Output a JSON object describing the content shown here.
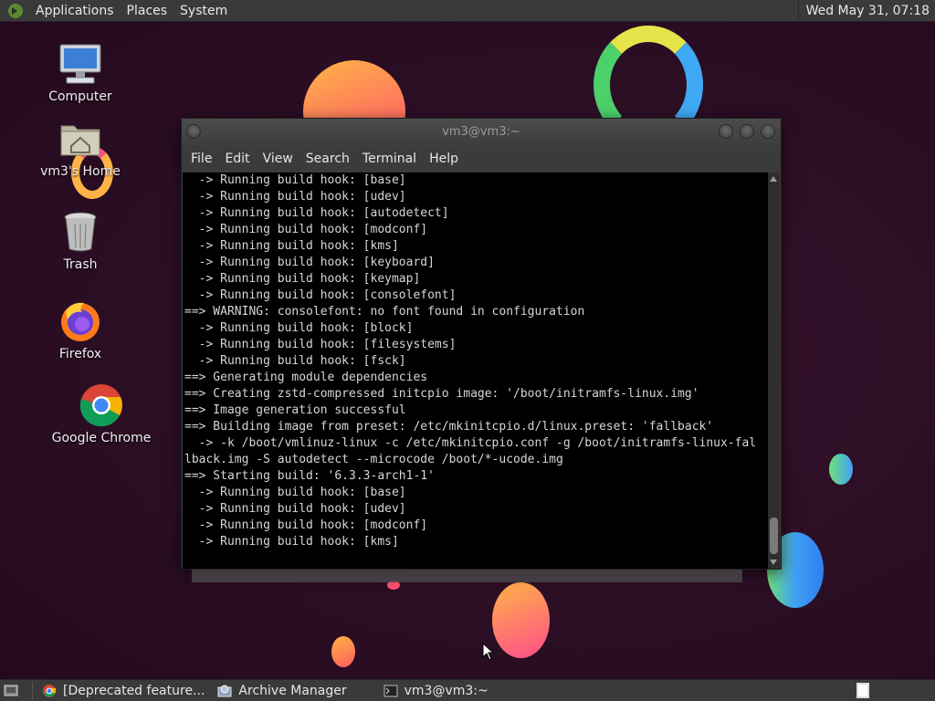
{
  "top_panel": {
    "menus": [
      "Applications",
      "Places",
      "System"
    ],
    "clock": "Wed May 31, 07:18"
  },
  "desktop_icons": [
    {
      "label": "Computer",
      "icon": "computer-icon"
    },
    {
      "label": "vm3's Home",
      "icon": "home-folder-icon"
    },
    {
      "label": "Trash",
      "icon": "trash-icon"
    },
    {
      "label": "Firefox",
      "icon": "firefox-icon"
    },
    {
      "label": "Google Chrome",
      "icon": "chrome-icon"
    }
  ],
  "terminal": {
    "title": "vm3@vm3:~",
    "menu": [
      "File",
      "Edit",
      "View",
      "Search",
      "Terminal",
      "Help"
    ],
    "lines": [
      "  -> Running build hook: [base]",
      "  -> Running build hook: [udev]",
      "  -> Running build hook: [autodetect]",
      "  -> Running build hook: [modconf]",
      "  -> Running build hook: [kms]",
      "  -> Running build hook: [keyboard]",
      "  -> Running build hook: [keymap]",
      "  -> Running build hook: [consolefont]",
      "==> WARNING: consolefont: no font found in configuration",
      "  -> Running build hook: [block]",
      "  -> Running build hook: [filesystems]",
      "  -> Running build hook: [fsck]",
      "==> Generating module dependencies",
      "==> Creating zstd-compressed initcpio image: '/boot/initramfs-linux.img'",
      "==> Image generation successful",
      "==> Building image from preset: /etc/mkinitcpio.d/linux.preset: 'fallback'",
      "  -> -k /boot/vmlinuz-linux -c /etc/mkinitcpio.conf -g /boot/initramfs-linux-fal",
      "lback.img -S autodetect --microcode /boot/*-ucode.img",
      "==> Starting build: '6.3.3-arch1-1'",
      "  -> Running build hook: [base]",
      "  -> Running build hook: [udev]",
      "  -> Running build hook: [modconf]",
      "  -> Running build hook: [kms]"
    ]
  },
  "taskbar": {
    "items": [
      {
        "label": "[Deprecated feature...",
        "icon": "chrome-icon"
      },
      {
        "label": "Archive Manager",
        "icon": "archive-manager-icon"
      },
      {
        "label": "vm3@vm3:~",
        "icon": "terminal-icon"
      }
    ]
  },
  "colors": {
    "background": "#2b0e24",
    "panel": "#3a3a3a",
    "terminal_bg": "#000000",
    "terminal_fg": "#d6d6d6"
  }
}
